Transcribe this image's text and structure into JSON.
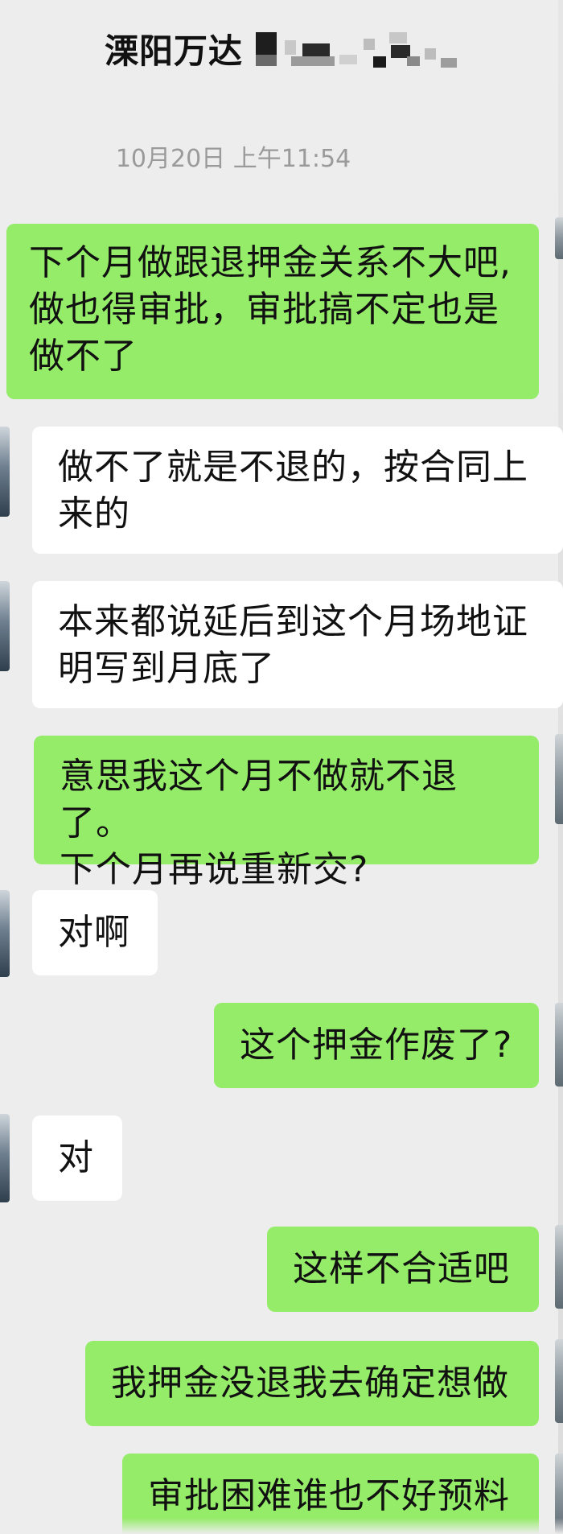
{
  "header": {
    "title": "溧阳万达"
  },
  "timestamp": "10月20日 上午11:54",
  "messages": [
    {
      "from": "me",
      "lines": [
        "下个月做跟退押金关系不大吧,",
        "做也得审批，审批搞不定也是",
        "做不了"
      ]
    },
    {
      "from": "them",
      "lines": [
        "做不了就是不退的，按合同上",
        "来的"
      ]
    },
    {
      "from": "them",
      "lines": [
        "本来都说延后到这个月场地证",
        "明写到月底了"
      ]
    },
    {
      "from": "me",
      "lines": [
        "意思我这个月不做就不退了。",
        "下个月再说重新交?"
      ]
    },
    {
      "from": "them",
      "lines": [
        "对啊"
      ]
    },
    {
      "from": "me",
      "lines": [
        "这个押金作废了?"
      ]
    },
    {
      "from": "them",
      "lines": [
        "对"
      ]
    },
    {
      "from": "me",
      "lines": [
        "这样不合适吧"
      ]
    },
    {
      "from": "me",
      "lines": [
        "我押金没退我去确定想做"
      ]
    },
    {
      "from": "me",
      "lines": [
        "审批困难谁也不好预料"
      ]
    }
  ],
  "colors": {
    "background": "#ededed",
    "my_bubble": "#95ec69",
    "their_bubble": "#ffffff",
    "timestamp": "#9a9a9a"
  }
}
